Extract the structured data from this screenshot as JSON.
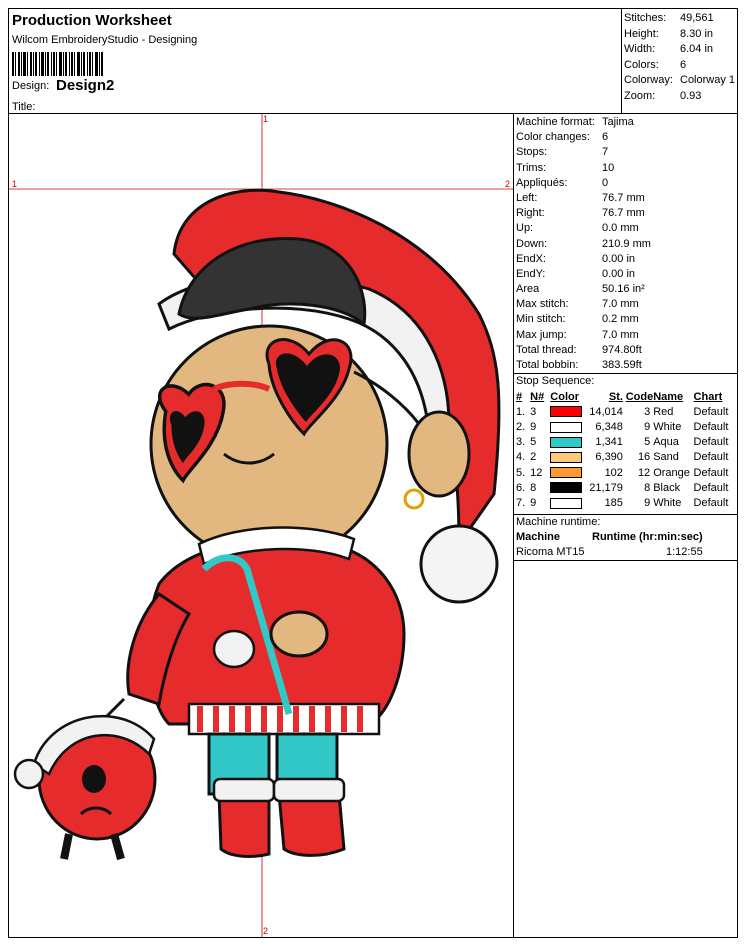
{
  "header": {
    "title": "Production Worksheet",
    "subtitle": "Wilcom EmbroideryStudio - Designing",
    "design_label": "Design:",
    "design_value": "Design2",
    "title_label": "Title:"
  },
  "stats": [
    {
      "k": "Stitches:",
      "v": "49,561"
    },
    {
      "k": "Height:",
      "v": "8.30 in"
    },
    {
      "k": "Width:",
      "v": "6.04 in"
    },
    {
      "k": "Colors:",
      "v": "6"
    },
    {
      "k": "Colorway:",
      "v": "Colorway 1"
    },
    {
      "k": "Zoom:",
      "v": "0.93"
    }
  ],
  "machine": [
    {
      "k": "Machine format:",
      "v": "Tajima"
    },
    {
      "k": "Color changes:",
      "v": "6"
    },
    {
      "k": "Stops:",
      "v": "7"
    },
    {
      "k": "Trims:",
      "v": "10"
    },
    {
      "k": "Appliqués:",
      "v": "0"
    },
    {
      "k": "Left:",
      "v": "76.7 mm"
    },
    {
      "k": "Right:",
      "v": "76.7 mm"
    },
    {
      "k": "Up:",
      "v": "0.0 mm"
    },
    {
      "k": "Down:",
      "v": "210.9 mm"
    },
    {
      "k": "EndX:",
      "v": "0.00 in"
    },
    {
      "k": "EndY:",
      "v": "0.00 in"
    },
    {
      "k": "Area",
      "v": "50.16 in²"
    },
    {
      "k": "Max stitch:",
      "v": "7.0 mm"
    },
    {
      "k": "Min stitch:",
      "v": "0.2 mm"
    },
    {
      "k": "Max jump:",
      "v": "7.0 mm"
    },
    {
      "k": "Total thread:",
      "v": "974.80ft"
    },
    {
      "k": "Total bobbin:",
      "v": "383.59ft"
    }
  ],
  "stop_sequence": {
    "title": "Stop Sequence:",
    "headers": [
      "#",
      "N#",
      "Color",
      "St.",
      "Code",
      "Name",
      "Chart"
    ],
    "rows": [
      {
        "idx": "1.",
        "n": "3",
        "color": "#ff0000",
        "st": "14,014",
        "code": "3",
        "name": "Red",
        "chart": "Default"
      },
      {
        "idx": "2.",
        "n": "9",
        "color": "#ffffff",
        "st": "6,348",
        "code": "9",
        "name": "White",
        "chart": "Default"
      },
      {
        "idx": "3.",
        "n": "5",
        "color": "#33c8c8",
        "st": "1,341",
        "code": "5",
        "name": "Aqua",
        "chart": "Default"
      },
      {
        "idx": "4.",
        "n": "2",
        "color": "#ffc878",
        "st": "6,390",
        "code": "16",
        "name": "Sand",
        "chart": "Default"
      },
      {
        "idx": "5.",
        "n": "12",
        "color": "#ff9933",
        "st": "102",
        "code": "12",
        "name": "Orange",
        "chart": "Default"
      },
      {
        "idx": "6.",
        "n": "8",
        "color": "#000000",
        "st": "21,179",
        "code": "8",
        "name": "Black",
        "chart": "Default"
      },
      {
        "idx": "7.",
        "n": "9",
        "color": "#ffffff",
        "st": "185",
        "code": "9",
        "name": "White",
        "chart": "Default"
      }
    ]
  },
  "runtime": {
    "title": "Machine runtime:",
    "col_machine": "Machine",
    "col_runtime": "Runtime (hr:min:sec)",
    "machine": "Ricoma MT15",
    "time": "1:12:55"
  },
  "markers": {
    "top": "1",
    "left": "1",
    "right": "2",
    "bottom": "2"
  }
}
